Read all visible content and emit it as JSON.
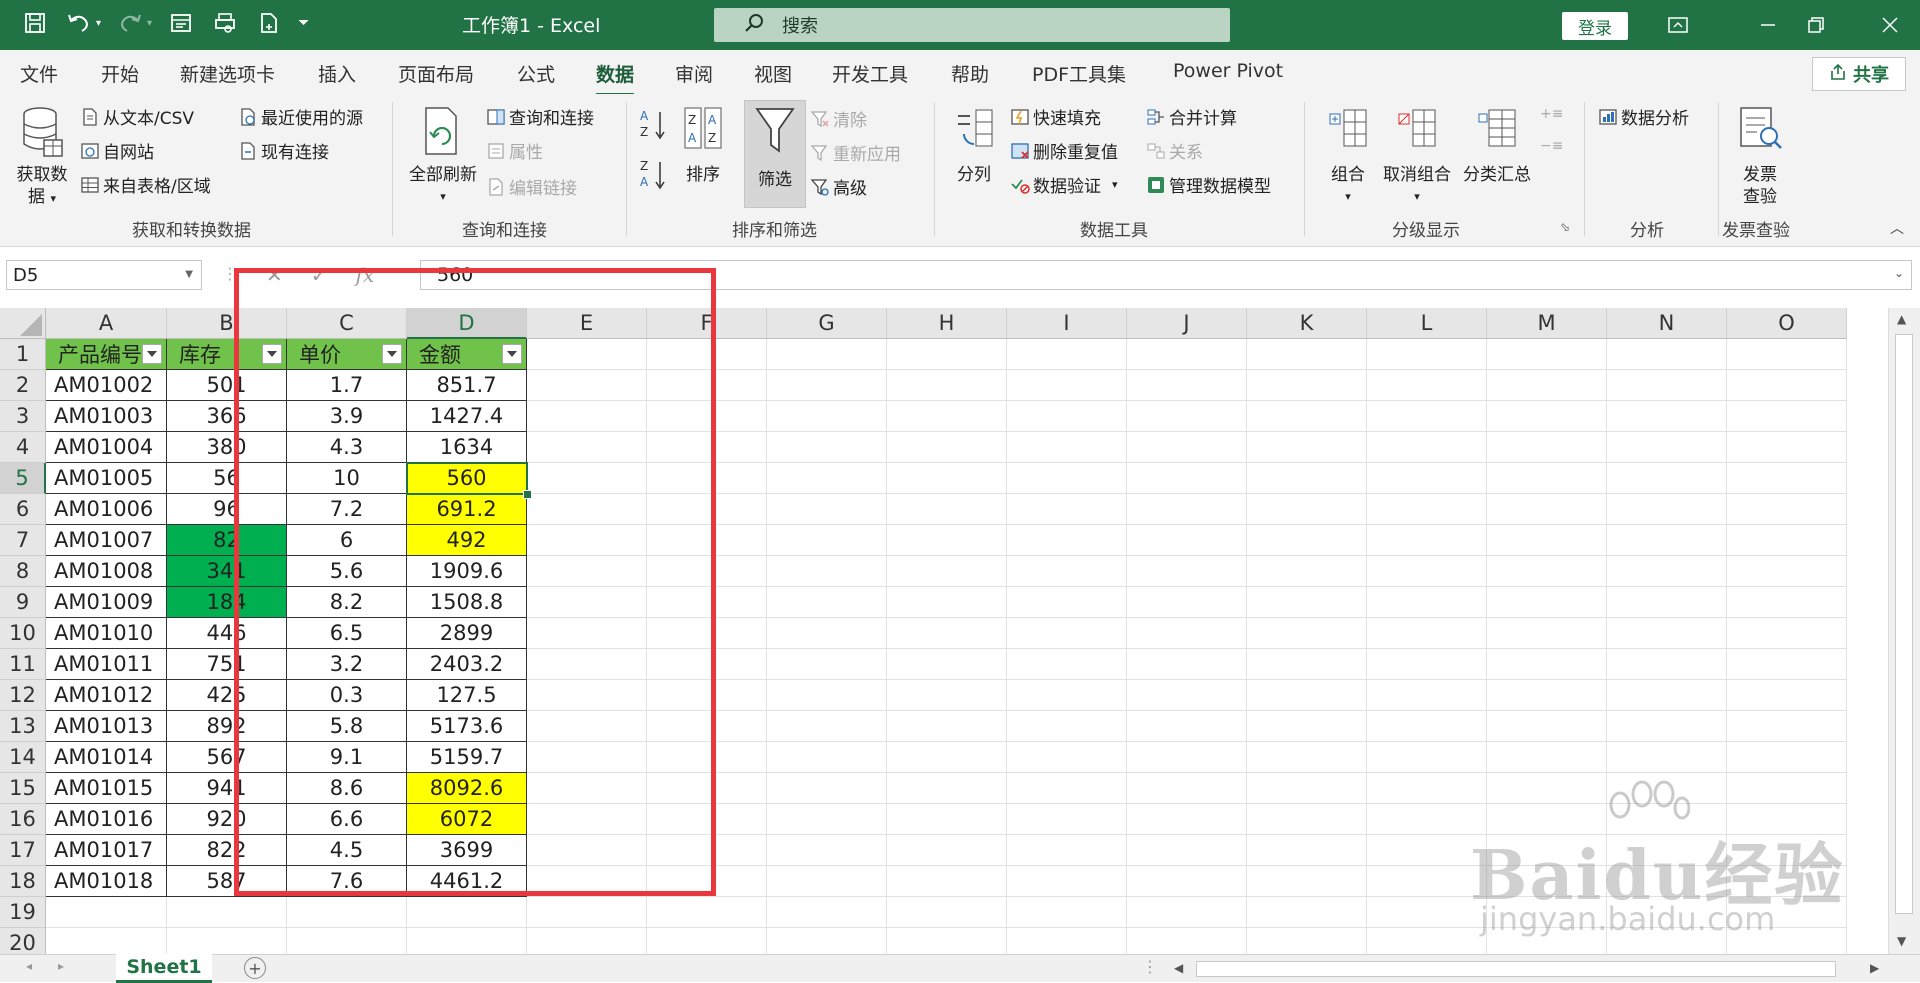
{
  "titlebar": {
    "doc_title": "工作簿1  -  Excel",
    "search_placeholder": "搜索",
    "login_label": "登录"
  },
  "tabs": [
    "文件",
    "开始",
    "新建选项卡",
    "插入",
    "页面布局",
    "公式",
    "数据",
    "审阅",
    "视图",
    "开发工具",
    "帮助",
    "PDF工具集",
    "Power Pivot"
  ],
  "active_tab": "数据",
  "share_label": "共享",
  "ribbon": {
    "get_data": {
      "label_line1": "获取数",
      "label_line2": "据"
    },
    "from_text_csv": "从文本/CSV",
    "from_web": "自网站",
    "from_table": "来自表格/区域",
    "recent_sources": "最近使用的源",
    "existing_conn": "现有连接",
    "group1_label": "获取和转换数据",
    "refresh_all": "全部刷新",
    "queries_conn": "查询和连接",
    "properties": "属性",
    "edit_links": "编辑链接",
    "group2_label": "查询和连接",
    "sort": "排序",
    "filter": "筛选",
    "clear": "清除",
    "reapply": "重新应用",
    "advanced": "高级",
    "group3_label": "排序和筛选",
    "text_to_columns": "分列",
    "flash_fill": "快速填充",
    "remove_dup": "删除重复值",
    "data_validation": "数据验证",
    "consolidate": "合并计算",
    "relationships": "关系",
    "manage_model": "管理数据模型",
    "group4_label": "数据工具",
    "group_btn": "组合",
    "ungroup_btn": "取消组合",
    "subtotal_btn": "分类汇总",
    "group5_label": "分级显示",
    "data_analysis": "数据分析",
    "group6_label": "分析",
    "invoice_line1": "发票",
    "invoice_line2": "查验",
    "group7_label": "发票查验"
  },
  "formula_bar": {
    "name_box": "D5",
    "formula": "560"
  },
  "columns": [
    "A",
    "B",
    "C",
    "D",
    "E",
    "F",
    "G",
    "H",
    "I",
    "J",
    "K",
    "L",
    "M",
    "N",
    "O"
  ],
  "selected_column": "D",
  "selected_row": "5",
  "table": {
    "headers": [
      "产品编号",
      "库存",
      "单价",
      "金额"
    ],
    "rows": [
      [
        "AM01002",
        "501",
        "1.7",
        "851.7"
      ],
      [
        "AM01003",
        "366",
        "3.9",
        "1427.4"
      ],
      [
        "AM01004",
        "380",
        "4.3",
        "1634"
      ],
      [
        "AM01005",
        "56",
        "10",
        "560"
      ],
      [
        "AM01006",
        "96",
        "7.2",
        "691.2"
      ],
      [
        "AM01007",
        "82",
        "6",
        "492"
      ],
      [
        "AM01008",
        "341",
        "5.6",
        "1909.6"
      ],
      [
        "AM01009",
        "184",
        "8.2",
        "1508.8"
      ],
      [
        "AM01010",
        "446",
        "6.5",
        "2899"
      ],
      [
        "AM01011",
        "751",
        "3.2",
        "2403.2"
      ],
      [
        "AM01012",
        "425",
        "0.3",
        "127.5"
      ],
      [
        "AM01013",
        "892",
        "5.8",
        "5173.6"
      ],
      [
        "AM01014",
        "567",
        "9.1",
        "5159.7"
      ],
      [
        "AM01015",
        "941",
        "8.6",
        "8092.6"
      ],
      [
        "AM01016",
        "920",
        "6.6",
        "6072"
      ],
      [
        "AM01017",
        "822",
        "4.5",
        "3699"
      ],
      [
        "AM01018",
        "587",
        "7.6",
        "4461.2"
      ]
    ],
    "green_stock_rows": [
      7,
      8,
      9
    ],
    "yellow_amount_rows": [
      5,
      6,
      7,
      15,
      16
    ]
  },
  "row_numbers": [
    "1",
    "2",
    "3",
    "4",
    "5",
    "6",
    "7",
    "8",
    "9",
    "10",
    "11",
    "12",
    "13",
    "14",
    "15",
    "16",
    "17",
    "18",
    "19",
    "20"
  ],
  "sheet_tab": "Sheet1",
  "watermark": {
    "brand": "Baidu经验",
    "url": "jingyan.baidu.com"
  },
  "colors": {
    "excel_green": "#217346",
    "header_fill": "#70c24a",
    "green_fill": "#00b050",
    "yellow_fill": "#ffff00",
    "annotation_red": "#e8373d"
  }
}
